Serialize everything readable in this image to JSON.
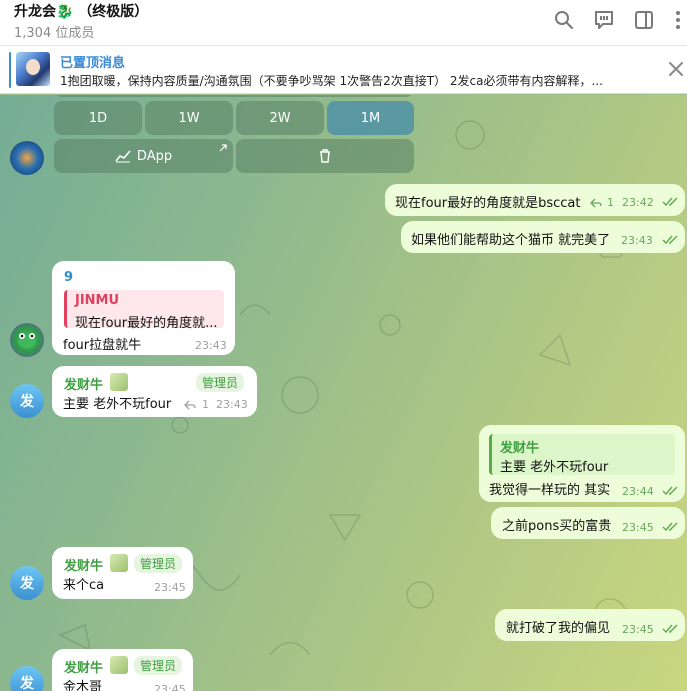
{
  "header": {
    "title": "升龙会🐉 （终极版）",
    "members": "1,304 位成员",
    "icons": [
      "search-icon",
      "discussion-icon",
      "sidebar-icon",
      "more-icon"
    ]
  },
  "pinned": {
    "title": "已置顶消息",
    "text": "1抱团取暖，保持内容质量/沟通氛围（不要争吵骂架 1次警告2次直接T） 2发ca必须带有内容解释，..."
  },
  "keyboard": {
    "row1": [
      "1D",
      "1W",
      "2W",
      "1M"
    ],
    "dapp_label": "DApp"
  },
  "messages": {
    "out1": {
      "text": "现在four最好的角度就是bsccat",
      "replies": "1",
      "time": "23:42"
    },
    "out2": {
      "text": "如果他们能帮助这个猫币 就完美了",
      "time": "23:43"
    },
    "in1": {
      "sender": "9",
      "reply_name": "JINMU",
      "reply_text": "现在four最好的角度就...",
      "text": "four拉盘就牛",
      "time": "23:43"
    },
    "in2": {
      "sender": "发财牛",
      "admin": "管理员",
      "text": "主要 老外不玩four",
      "replies": "1",
      "time": "23:43",
      "avatar": "发"
    },
    "out3": {
      "reply_name": "发财牛",
      "reply_text": "主要 老外不玩four",
      "text": "我觉得一样玩的 其实",
      "time": "23:44"
    },
    "out4": {
      "text": "之前pons买的富贵",
      "time": "23:45"
    },
    "in3": {
      "sender": "发财牛",
      "admin": "管理员",
      "text": "来个ca",
      "time": "23:45",
      "avatar": "发"
    },
    "out5": {
      "text": "就打破了我的偏见",
      "time": "23:45"
    },
    "in4": {
      "sender": "发财牛",
      "admin": "管理员",
      "text": "金木哥",
      "time": "23:45",
      "avatar": "发"
    }
  },
  "colors": {
    "accent": "#3a8ad6",
    "admin_green": "#3fa041",
    "out_bubble": "#eefdd9"
  }
}
